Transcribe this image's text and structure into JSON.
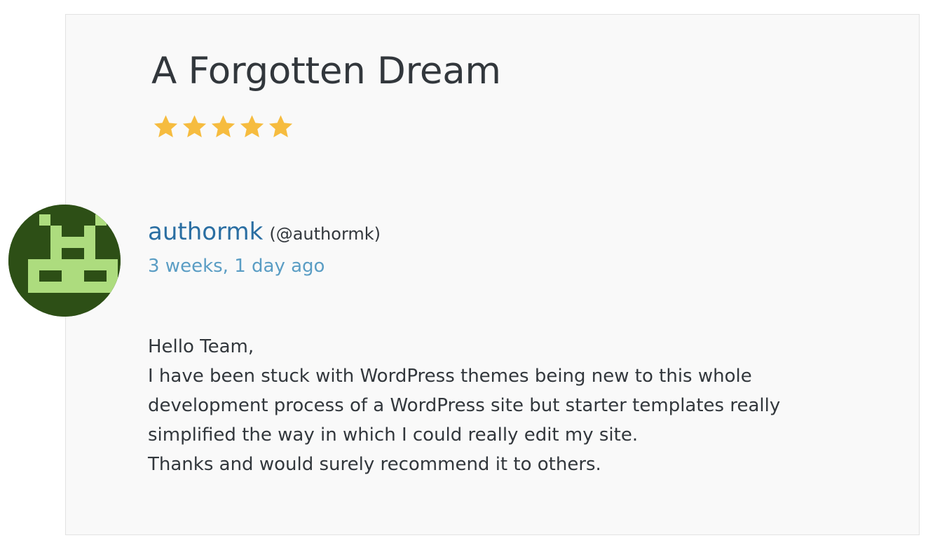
{
  "review": {
    "title": "A Forgotten Dream",
    "rating": 5,
    "rating_max": 5,
    "star_color": "#f6bc3f",
    "author": {
      "name": "authormk",
      "handle": "(@authormk)",
      "avatar_icon": "pixel-invader-avatar-icon",
      "avatar_colors": {
        "background": "#2d4f16",
        "pixels": "#addc7e"
      }
    },
    "date": "3 weeks, 1 day ago",
    "body_lines": [
      "Hello Team,",
      "I have been stuck with WordPress themes being new to this whole",
      "development process of a WordPress site but starter templates really",
      "simplified the way in which I could really edit my site.",
      "Thanks and would surely recommend it to others."
    ]
  },
  "colors": {
    "card_background": "#f9f9f9",
    "text": "#32373c",
    "link": "#2a6ea2",
    "date_link": "#5a9dc4"
  }
}
